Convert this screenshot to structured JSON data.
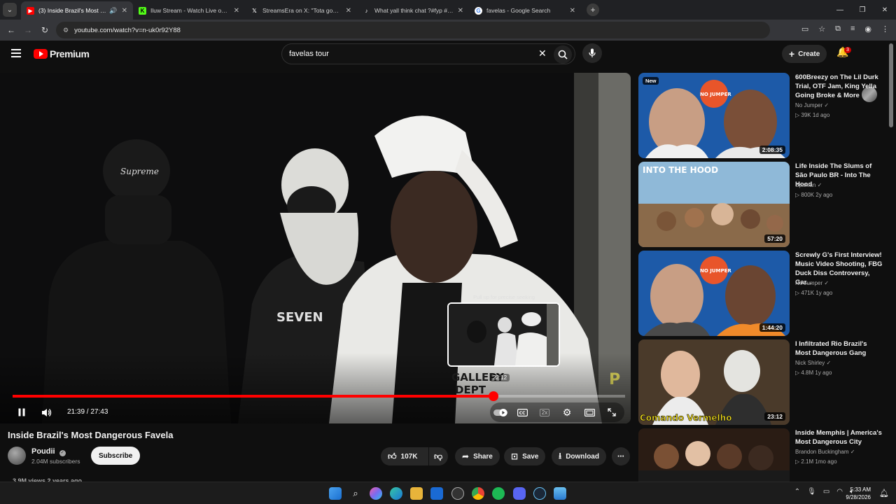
{
  "browser": {
    "tabs": [
      {
        "title": "(3) Inside Brazil's Most Dang",
        "icon": "youtube-icon",
        "color": "#ff0000",
        "active": true
      },
      {
        "title": "Iluw Stream - Watch Live on Ki",
        "icon": "kick-icon",
        "color": "#53fc18",
        "active": false
      },
      {
        "title": "StreamsEra on X: \"Tota goes off",
        "icon": "x-icon",
        "color": "#ffffff",
        "active": false
      },
      {
        "title": "What yall think chat ?#fyp #tot",
        "icon": "tiktok-icon",
        "color": "#ffffff",
        "active": false
      },
      {
        "title": "favelas - Google Search",
        "icon": "google-icon",
        "color": "#4285f4",
        "active": false
      }
    ],
    "url": "youtube.com/watch?v=n-uk0r92Y88"
  },
  "header": {
    "logo_text": "Premium",
    "search_value": "favelas tour",
    "create_label": "Create",
    "notification_count": "3"
  },
  "player": {
    "progress_fraction": 0.7855,
    "seek_hint": "Pull up for precise seeking",
    "hover_time": "22:12",
    "timecode": "21:39 / 27:43",
    "speed_label": "2x"
  },
  "video": {
    "title": "Inside Brazil's Most Dangerous Favela",
    "channel": "Poudii",
    "subscribers": "2.04M subscribers",
    "subscribe_label": "Subscribe",
    "likes": "107K",
    "share_label": "Share",
    "save_label": "Save",
    "download_label": "Download",
    "views_line": "3.9M views  2 years ago"
  },
  "recommendations": [
    {
      "title": "600Breezy on The Lil Durk Trial, OTF Jam, King Yella Going Broke & More",
      "channel": "No Jumper",
      "meta": "39K  1d ago",
      "duration": "2:08:35",
      "badge": "New",
      "thumb_text": "NO JUMPER"
    },
    {
      "title": "Life Inside The Slums of São Paulo BR - Into The Hood",
      "channel": "Spanian",
      "meta": "800K  2y ago",
      "duration": "57:20",
      "badge": "",
      "thumb_text": "INTO THE HOOD"
    },
    {
      "title": "Screwly G's First Interview! Music Video Shooting, FBG Duck Diss Controversy, Gar...",
      "channel": "No Jumper",
      "meta": "471K  1y ago",
      "duration": "1:44:20",
      "badge": "",
      "thumb_text": "NO JUMPER"
    },
    {
      "title": "I Infiltrated Rio Brazil's Most Dangerous Gang",
      "channel": "Nick Shirley",
      "meta": "4.8M  1y ago",
      "duration": "23:12",
      "badge": "",
      "thumb_text": "Comando Vermelho"
    },
    {
      "title": "Inside Memphis | America's Most Dangerous City",
      "channel": "Brandon Buckingham",
      "meta": "2.1M  1mo ago",
      "duration": "",
      "badge": "",
      "thumb_text": ""
    }
  ],
  "taskbar": {
    "time": "5:33 AM",
    "date": "9/28/2026"
  }
}
